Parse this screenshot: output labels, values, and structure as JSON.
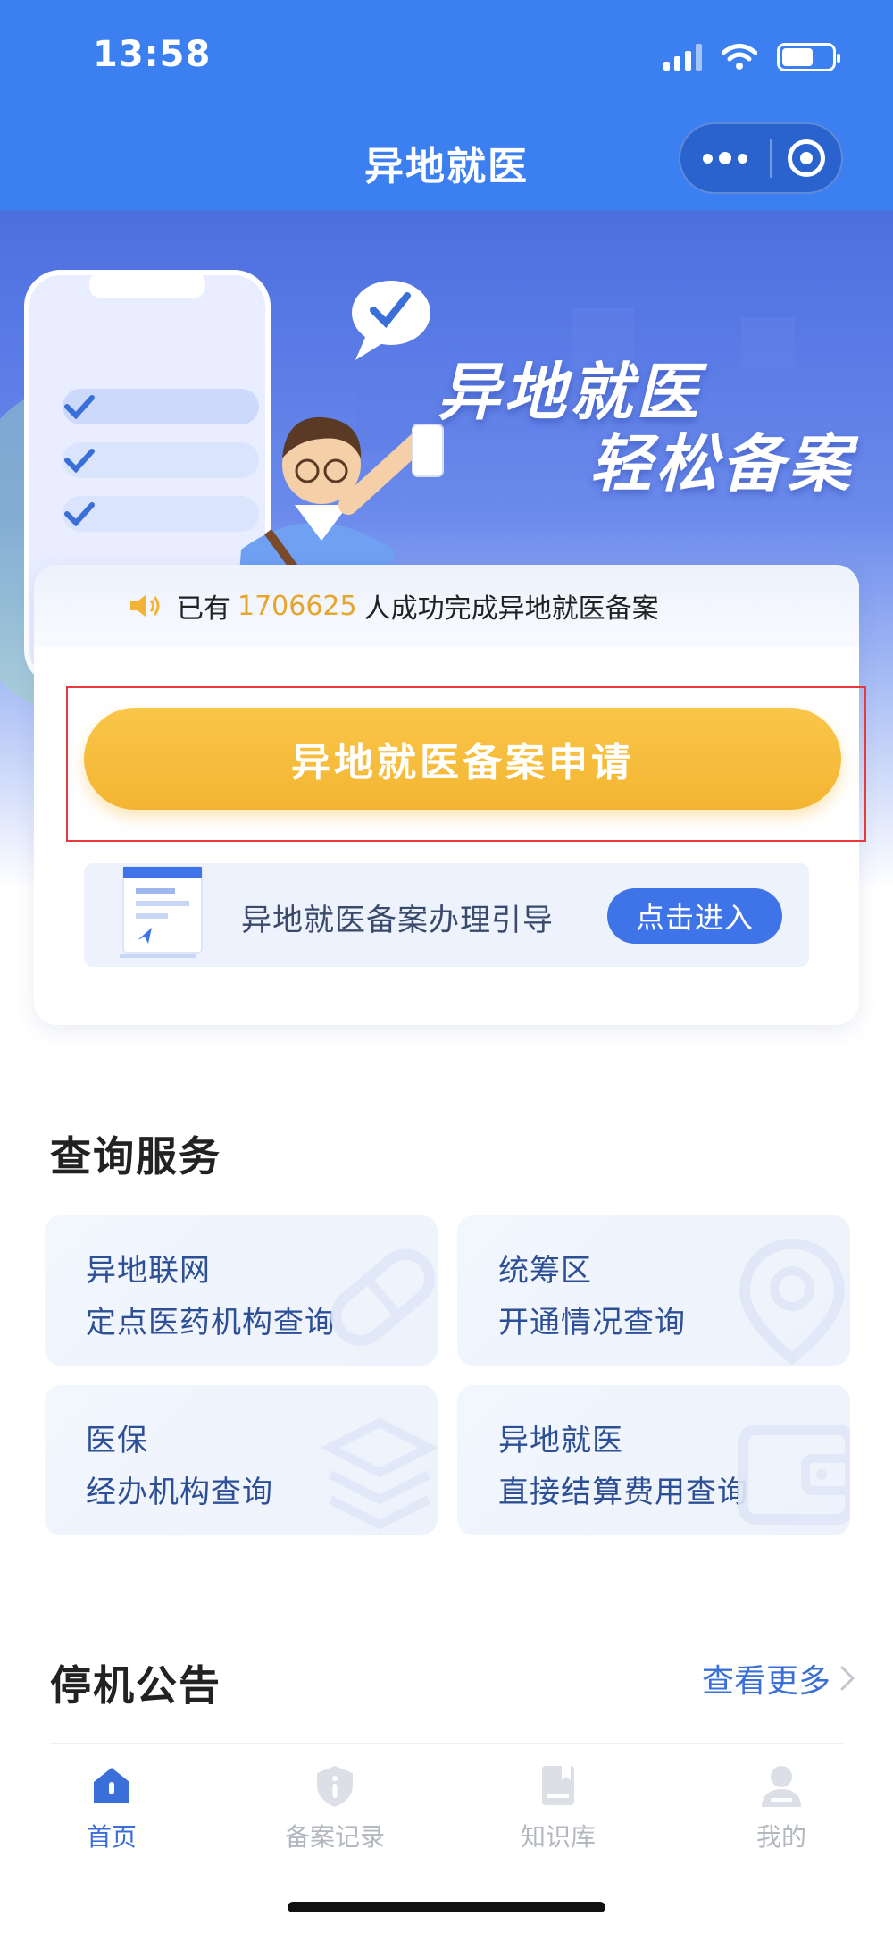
{
  "status_bar": {
    "time": "13:58"
  },
  "nav": {
    "title": "异地就医"
  },
  "banner": {
    "title_line1": "异地就医",
    "title_line2": "轻松备案"
  },
  "notice": {
    "prefix": "已有",
    "count": "1706625",
    "suffix": "人成功完成异地就医备案"
  },
  "apply_button": {
    "label": "异地就医备案申请"
  },
  "guide": {
    "text": "异地就医备案办理引导",
    "button_label": "点击进入"
  },
  "query_services": {
    "title": "查询服务",
    "items": [
      {
        "line1": "异地联网",
        "line2": "定点医药机构查询",
        "icon": "pill-icon"
      },
      {
        "line1": "统筹区",
        "line2": "开通情况查询",
        "icon": "location-pin-icon"
      },
      {
        "line1": "医保",
        "line2": "经办机构查询",
        "icon": "layers-icon"
      },
      {
        "line1": "异地就医",
        "line2": "直接结算费用查询",
        "icon": "wallet-icon"
      }
    ]
  },
  "announcement": {
    "title": "停机公告",
    "more_label": "查看更多"
  },
  "tabbar": {
    "items": [
      {
        "label": "首页",
        "icon": "home-icon",
        "active": true
      },
      {
        "label": "备案记录",
        "icon": "shield-info-icon",
        "active": false
      },
      {
        "label": "知识库",
        "icon": "book-icon",
        "active": false
      },
      {
        "label": "我的",
        "icon": "user-icon",
        "active": false
      }
    ]
  },
  "colors": {
    "primary": "#3b7ff0",
    "accent_yellow": "#f3b531",
    "count_color": "#e6a52e",
    "service_text": "#2d4f96",
    "tab_active": "#3a6fd8",
    "tab_inactive": "#b3b7c0",
    "highlight_frame": "#e53b3b"
  }
}
